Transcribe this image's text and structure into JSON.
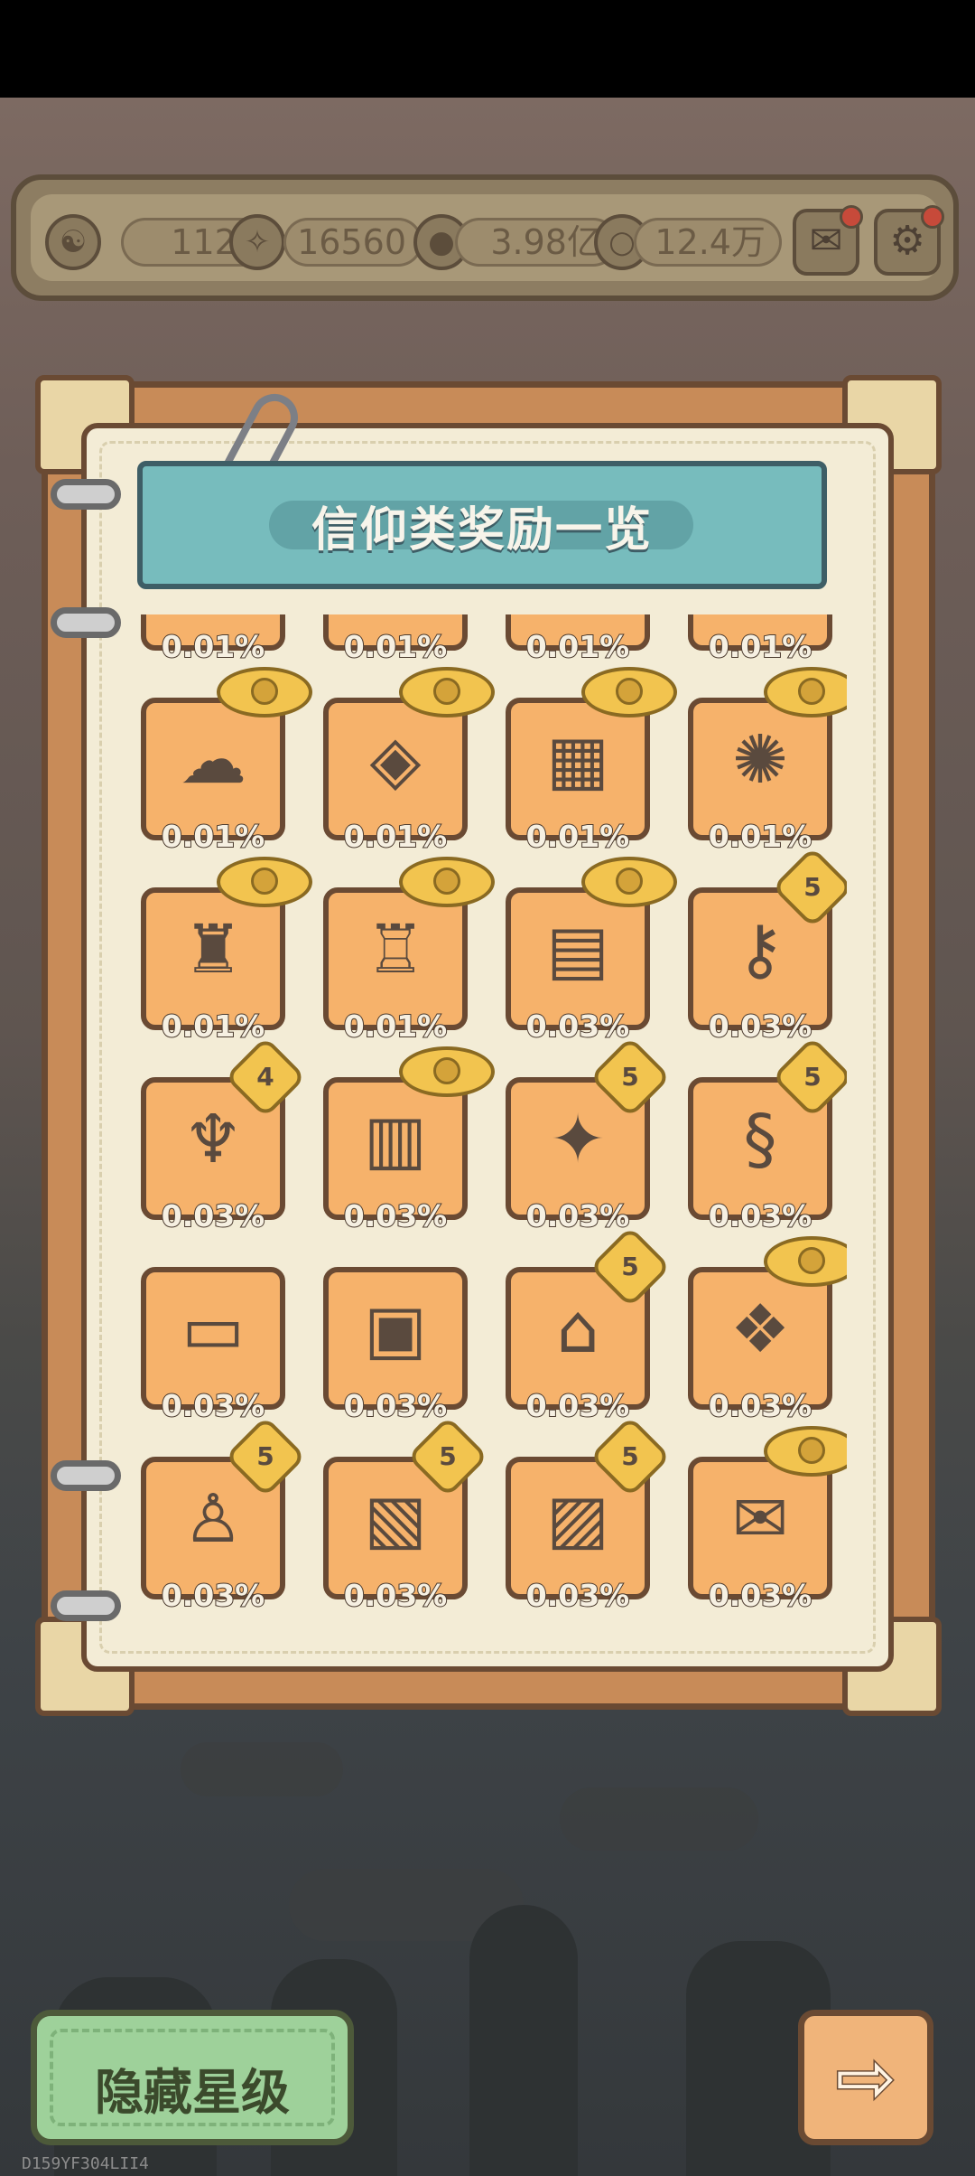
{
  "resources": [
    {
      "icon": "yin-yang-icon",
      "value": ""
    },
    {
      "icon": "swirl-icon",
      "value": "1121"
    },
    {
      "icon": "spirit-icon",
      "value": "16560"
    },
    {
      "icon": "speech-bubble-icon",
      "value": "3.98亿"
    },
    {
      "icon": "bubble-icon",
      "value": "12.4万"
    }
  ],
  "res_values": {
    "swirl": "1121",
    "spirit": "16560",
    "bubble_a": "3.98亿",
    "bubble_b": "12.4万"
  },
  "panel": {
    "title": "信仰类奖励一览"
  },
  "rewards": [
    {
      "name": "item",
      "pct": "0.01%",
      "badge": "none"
    },
    {
      "name": "item",
      "pct": "0.01%",
      "badge": "none"
    },
    {
      "name": "item",
      "pct": "0.01%",
      "badge": "none"
    },
    {
      "name": "item",
      "pct": "0.01%",
      "badge": "none"
    },
    {
      "name": "cloud-scarf",
      "pct": "0.01%",
      "badge": "wing"
    },
    {
      "name": "gem-amulet",
      "pct": "0.01%",
      "badge": "wing"
    },
    {
      "name": "stone-tablet",
      "pct": "0.01%",
      "badge": "wing"
    },
    {
      "name": "peacock-fan",
      "pct": "0.01%",
      "badge": "wing"
    },
    {
      "name": "bronze-vessel",
      "pct": "0.01%",
      "badge": "wing"
    },
    {
      "name": "golden-throne",
      "pct": "0.01%",
      "badge": "wing"
    },
    {
      "name": "red-tome",
      "pct": "0.03%",
      "badge": "wing"
    },
    {
      "name": "silver-key",
      "pct": "0.03%",
      "badge": "5"
    },
    {
      "name": "chalice",
      "pct": "0.03%",
      "badge": "4"
    },
    {
      "name": "parchment",
      "pct": "0.03%",
      "badge": "wing"
    },
    {
      "name": "crystal",
      "pct": "0.03%",
      "badge": "5"
    },
    {
      "name": "serpent-staff",
      "pct": "0.03%",
      "badge": "5"
    },
    {
      "name": "open-book",
      "pct": "0.03%",
      "badge": "none"
    },
    {
      "name": "diagram-book",
      "pct": "0.03%",
      "badge": "none"
    },
    {
      "name": "shrine",
      "pct": "0.03%",
      "badge": "5"
    },
    {
      "name": "spell-book",
      "pct": "0.03%",
      "badge": "wing"
    },
    {
      "name": "statue",
      "pct": "0.03%",
      "badge": "5"
    },
    {
      "name": "painting",
      "pct": "0.03%",
      "badge": "5"
    },
    {
      "name": "icon-painting",
      "pct": "0.03%",
      "badge": "5"
    },
    {
      "name": "old-map",
      "pct": "0.03%",
      "badge": "wing"
    }
  ],
  "glyphs": {
    "item": "◆",
    "cloud-scarf": "☁",
    "gem-amulet": "◈",
    "stone-tablet": "▦",
    "peacock-fan": "✺",
    "bronze-vessel": "♜",
    "golden-throne": "♖",
    "red-tome": "▤",
    "silver-key": "⚷",
    "chalice": "♆",
    "parchment": "▥",
    "crystal": "✦",
    "serpent-staff": "§",
    "open-book": "▭",
    "diagram-book": "▣",
    "shrine": "⌂",
    "spell-book": "❖",
    "statue": "♙",
    "painting": "▧",
    "icon-painting": "▨",
    "old-map": "✉"
  },
  "buttons": {
    "hide_stars": "隐藏星级",
    "next_arrow": "⇨"
  },
  "watermark": "D159YF304LII4"
}
